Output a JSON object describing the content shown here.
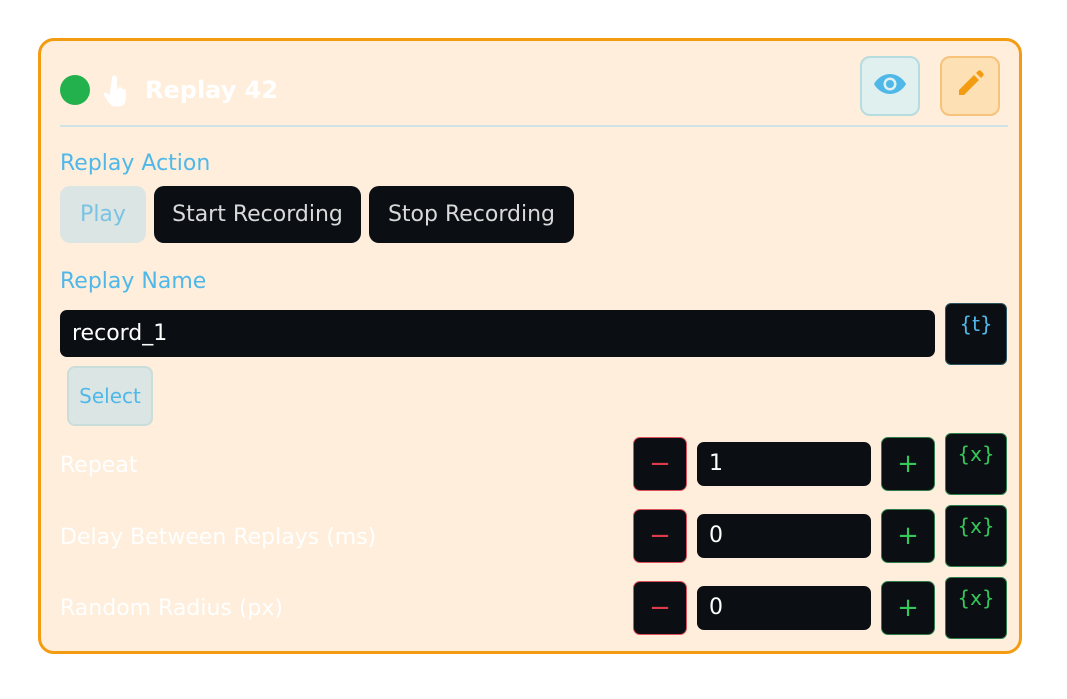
{
  "header": {
    "title": "Replay 42",
    "status_color": "#22b14c",
    "icon": "hand-pointer-icon",
    "eye_icon": "eye-icon",
    "edit_icon": "pencil-icon"
  },
  "replay_action": {
    "label": "Replay Action",
    "options": [
      "Play",
      "Start Recording",
      "Stop Recording"
    ],
    "selected": "Play"
  },
  "replay_name": {
    "label": "Replay Name",
    "value": "record_1",
    "variable_button": "{t}",
    "select_button": "Select"
  },
  "fields": [
    {
      "label": "Repeat",
      "value": "1",
      "minus": "−",
      "plus": "+",
      "variable_button": "{x}"
    },
    {
      "label": "Delay Between Replays (ms)",
      "value": "0",
      "minus": "−",
      "plus": "+",
      "variable_button": "{x}"
    },
    {
      "label": "Random Radius (px)",
      "value": "0",
      "minus": "−",
      "plus": "+",
      "variable_button": "{x}"
    }
  ],
  "colors": {
    "accent_border": "#f39c12",
    "card_background": "#feeedb",
    "label_blue": "#4fb8e9"
  }
}
